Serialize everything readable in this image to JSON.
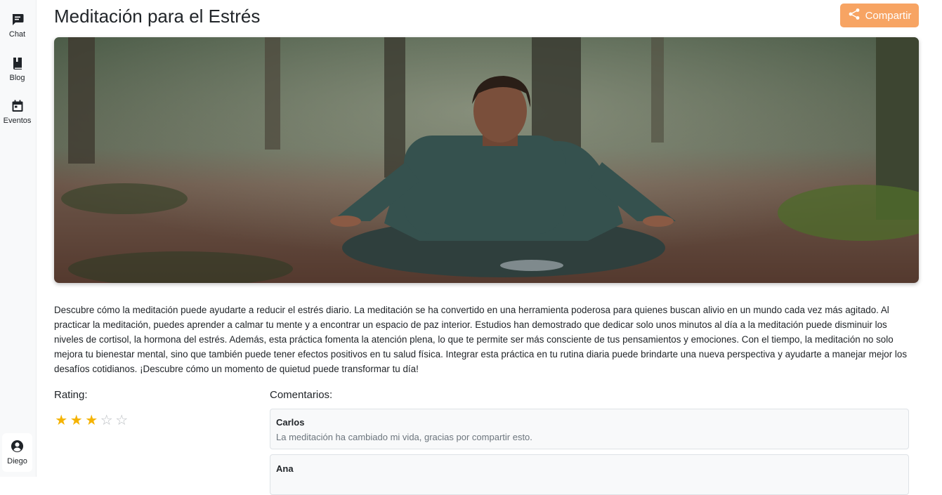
{
  "sidebar": {
    "items": [
      {
        "label": "Chat",
        "icon": "chat-icon"
      },
      {
        "label": "Blog",
        "icon": "book-icon"
      },
      {
        "label": "Eventos",
        "icon": "calendar-icon"
      }
    ],
    "user": {
      "label": "Diego",
      "icon": "user-circle-icon"
    }
  },
  "header": {
    "title": "Meditación para el Estrés",
    "share_label": "Compartir",
    "share_color": "#f7a463"
  },
  "hero": {
    "image": "man-meditating-in-forest"
  },
  "article": {
    "description": "Descubre cómo la meditación puede ayudarte a reducir el estrés diario. La meditación se ha convertido en una herramienta poderosa para quienes buscan alivio en un mundo cada vez más agitado. Al practicar la meditación, puedes aprender a calmar tu mente y a encontrar un espacio de paz interior. Estudios han demostrado que dedicar solo unos minutos al día a la meditación puede disminuir los niveles de cortisol, la hormona del estrés. Además, esta práctica fomenta la atención plena, lo que te permite ser más consciente de tus pensamientos y emociones. Con el tiempo, la meditación no solo mejora tu bienestar mental, sino que también puede tener efectos positivos en tu salud física. Integrar esta práctica en tu rutina diaria puede brindarte una nueva perspectiva y ayudarte a manejar mejor los desafíos cotidianos. ¡Descubre cómo un momento de quietud puede transformar tu día!"
  },
  "rating": {
    "title": "Rating:",
    "value": 3,
    "max": 5,
    "star_color": "#f5b301"
  },
  "comments": {
    "title": "Comentarios:",
    "items": [
      {
        "author": "Carlos",
        "text": "La meditación ha cambiado mi vida, gracias por compartir esto."
      },
      {
        "author": "Ana",
        "text": ""
      }
    ]
  }
}
